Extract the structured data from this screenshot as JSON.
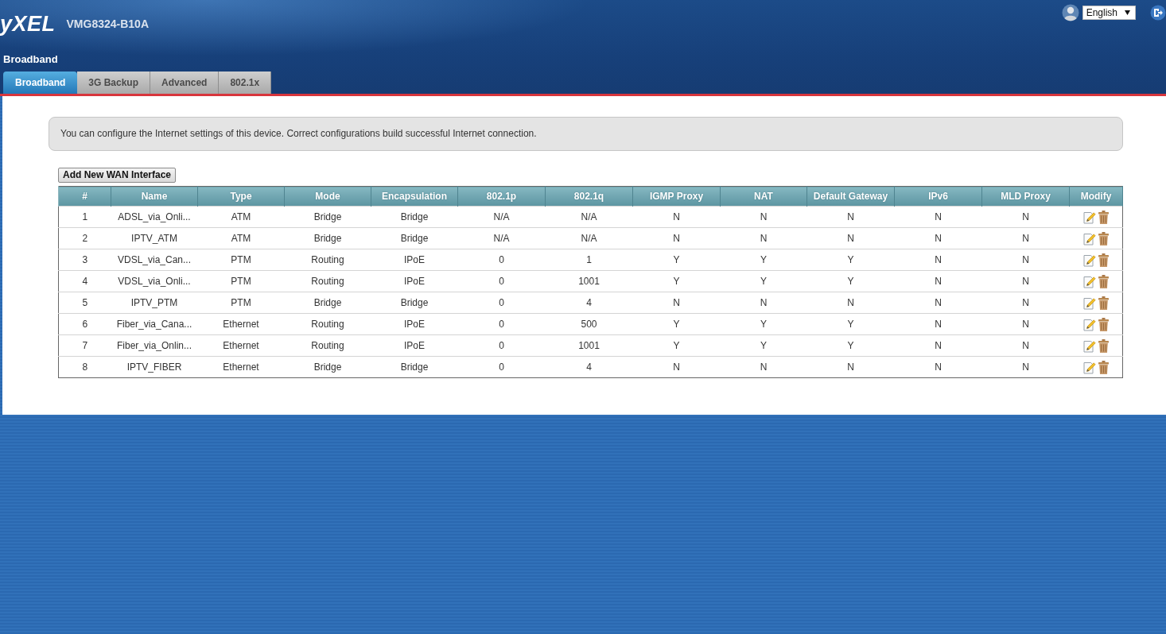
{
  "header": {
    "logo": "yXEL",
    "model": "VMG8324-B10A",
    "language": "English"
  },
  "page_title": "Broadband",
  "tabs": [
    {
      "label": "Broadband",
      "selected": true
    },
    {
      "label": "3G Backup",
      "selected": false
    },
    {
      "label": "Advanced",
      "selected": false
    },
    {
      "label": "802.1x",
      "selected": false
    }
  ],
  "notice": "You can configure the Internet settings of this device. Correct configurations build successful Internet connection.",
  "add_button": "Add New WAN Interface",
  "table": {
    "columns": [
      "#",
      "Name",
      "Type",
      "Mode",
      "Encapsulation",
      "802.1p",
      "802.1q",
      "IGMP Proxy",
      "NAT",
      "Default Gateway",
      "IPv6",
      "MLD Proxy",
      "Modify"
    ],
    "rows": [
      [
        "1",
        "ADSL_via_Onli...",
        "ATM",
        "Bridge",
        "Bridge",
        "N/A",
        "N/A",
        "N",
        "N",
        "N",
        "N",
        "N"
      ],
      [
        "2",
        "IPTV_ATM",
        "ATM",
        "Bridge",
        "Bridge",
        "N/A",
        "N/A",
        "N",
        "N",
        "N",
        "N",
        "N"
      ],
      [
        "3",
        "VDSL_via_Can...",
        "PTM",
        "Routing",
        "IPoE",
        "0",
        "1",
        "Y",
        "Y",
        "Y",
        "N",
        "N"
      ],
      [
        "4",
        "VDSL_via_Onli...",
        "PTM",
        "Routing",
        "IPoE",
        "0",
        "1001",
        "Y",
        "Y",
        "Y",
        "N",
        "N"
      ],
      [
        "5",
        "IPTV_PTM",
        "PTM",
        "Bridge",
        "Bridge",
        "0",
        "4",
        "N",
        "N",
        "N",
        "N",
        "N"
      ],
      [
        "6",
        "Fiber_via_Cana...",
        "Ethernet",
        "Routing",
        "IPoE",
        "0",
        "500",
        "Y",
        "Y",
        "Y",
        "N",
        "N"
      ],
      [
        "7",
        "Fiber_via_Onlin...",
        "Ethernet",
        "Routing",
        "IPoE",
        "0",
        "1001",
        "Y",
        "Y",
        "Y",
        "N",
        "N"
      ],
      [
        "8",
        "IPTV_FIBER",
        "Ethernet",
        "Bridge",
        "Bridge",
        "0",
        "4",
        "N",
        "N",
        "N",
        "N",
        "N"
      ]
    ]
  }
}
